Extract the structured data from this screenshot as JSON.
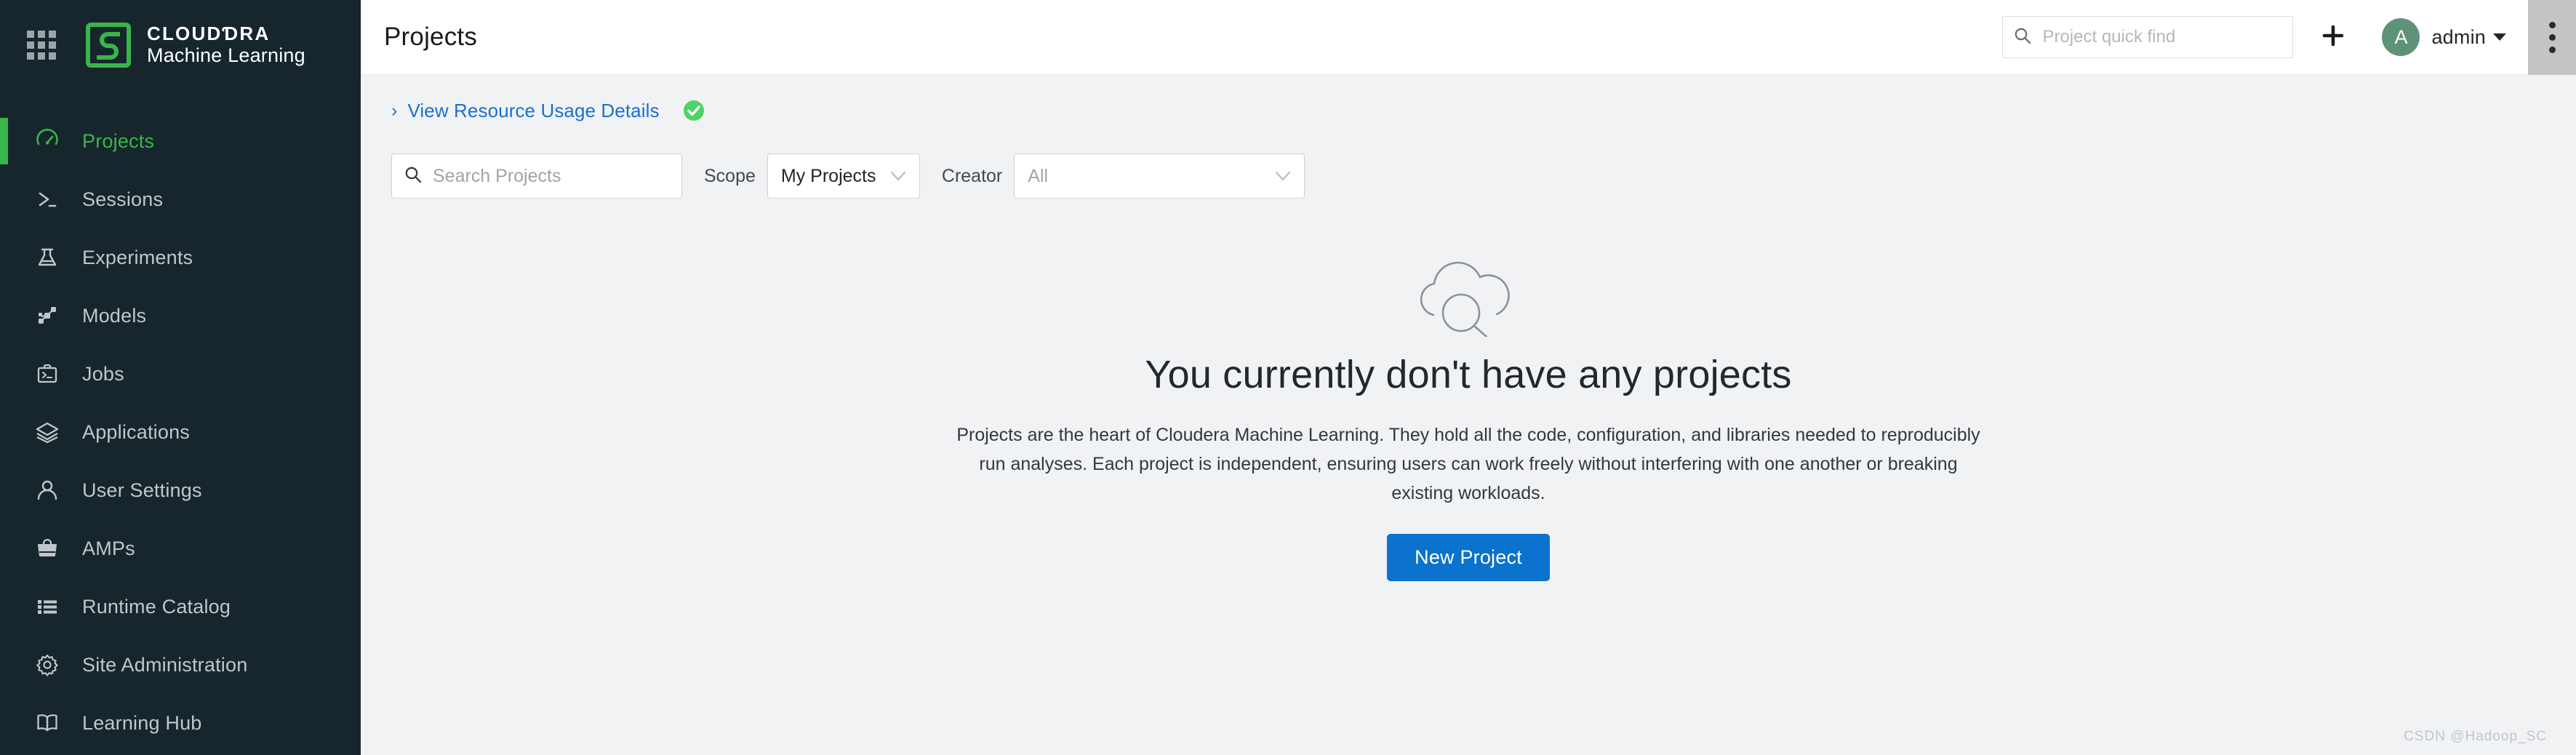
{
  "brand": {
    "line1": "CLOUDƊRA",
    "line2": "Machine Learning",
    "app_grid_icon": "app-grid-icon",
    "logo_icon": "cloudera-logo-icon",
    "accent_color": "#39b54a"
  },
  "sidebar": {
    "background_color": "#17262c",
    "items": [
      {
        "label": "Projects",
        "icon": "gauge-icon",
        "active": true
      },
      {
        "label": "Sessions",
        "icon": "terminal-icon",
        "active": false
      },
      {
        "label": "Experiments",
        "icon": "flask-icon",
        "active": false
      },
      {
        "label": "Models",
        "icon": "network-icon",
        "active": false
      },
      {
        "label": "Jobs",
        "icon": "briefcase-icon",
        "active": false
      },
      {
        "label": "Applications",
        "icon": "layers-icon",
        "active": false
      },
      {
        "label": "User Settings",
        "icon": "user-icon",
        "active": false
      },
      {
        "label": "AMPs",
        "icon": "shopping-bag-icon",
        "active": false
      },
      {
        "label": "Runtime Catalog",
        "icon": "list-icon",
        "active": false
      },
      {
        "label": "Site Administration",
        "icon": "gear-icon",
        "active": false
      },
      {
        "label": "Learning Hub",
        "icon": "book-icon",
        "active": false
      }
    ]
  },
  "header": {
    "title": "Projects",
    "quick_find_placeholder": "Project quick find",
    "quick_find_value": "",
    "search_icon": "search-icon",
    "add_icon": "plus-icon",
    "user": {
      "avatar_initial": "A",
      "name": "admin",
      "avatar_color": "#5e9279",
      "caret_icon": "caret-down-icon"
    },
    "overflow_icon": "kebab-menu-icon"
  },
  "resource_usage": {
    "link_label": "View Resource Usage Details",
    "chevron_icon": "chevron-right-icon",
    "status_icon": "check-circle-icon",
    "status_color": "#4cd464",
    "link_color": "#1b6fd4"
  },
  "filters": {
    "search_placeholder": "Search Projects",
    "search_value": "",
    "search_icon": "search-icon",
    "scope_label": "Scope",
    "scope_value": "My Projects",
    "creator_label": "Creator",
    "creator_placeholder": "All",
    "dropdown_icon": "chevron-down-icon"
  },
  "empty_state": {
    "illustration_icon": "cloud-search-icon",
    "title": "You currently don't have any projects",
    "description": "Projects are the heart of Cloudera Machine Learning. They hold all the code, configuration, and libraries needed to reproducibly run analyses. Each project is independent, ensuring users can work freely without interfering with one another or breaking existing workloads.",
    "button_label": "New Project",
    "button_color": "#0b72cd"
  },
  "watermark": "CSDN @Hadoop_SC"
}
